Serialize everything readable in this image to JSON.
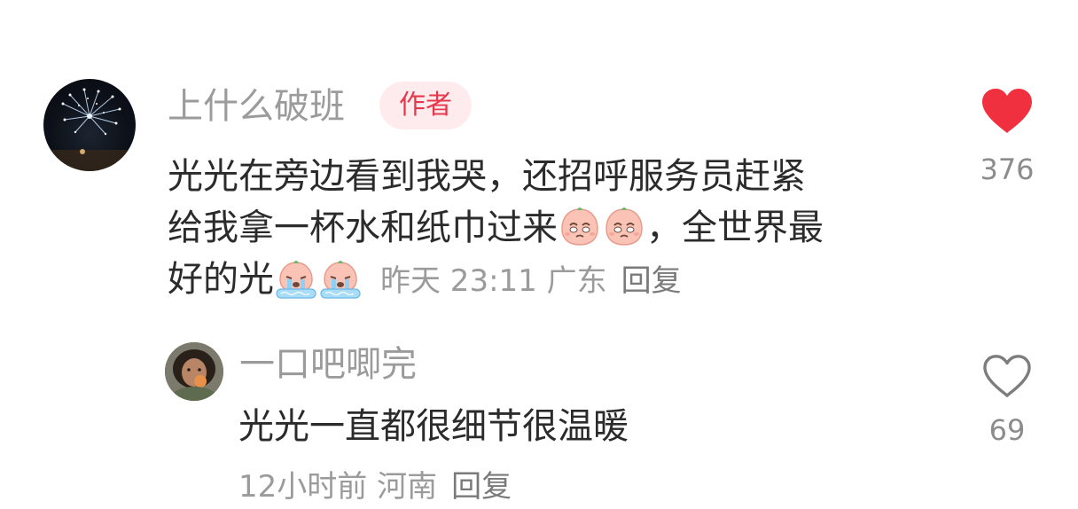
{
  "main_comment": {
    "username": "上什么破班",
    "badge": "作者",
    "content_line1": "光光在旁边看到我哭，还招呼服务员赶紧",
    "content_line2_a": "给我拿一杯水和纸巾过来",
    "content_line2_b": "，全世界最",
    "content_line3": "好的光",
    "emojis": [
      "pleading-face-emoji",
      "pleading-face-emoji",
      "crying-face-emoji",
      "crying-face-emoji"
    ],
    "time": "昨天 23:11",
    "location": "广东",
    "reply_label": "回复",
    "likes": "376",
    "liked": true,
    "like_color": "#f0303e"
  },
  "reply_comment": {
    "username": "一口吧唧完",
    "content": "光光一直都很细节很温暖",
    "time": "12小时前",
    "location": "河南",
    "reply_label": "回复",
    "likes": "69",
    "liked": false
  }
}
